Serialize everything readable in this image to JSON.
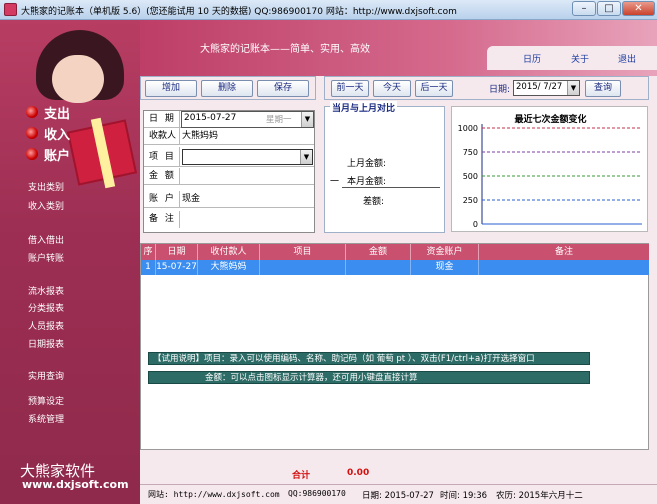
{
  "window": {
    "title": "大熊家的记账本（单机版 5.6）(您还能试用 10 天的数据)  QQ:986900170  网站：http://www.dxjsoft.com",
    "minimize": "–",
    "maximize": "□",
    "close": "✕"
  },
  "header": {
    "tagline": "大熊家的记账本——简单、实用、高效",
    "tabs": [
      "日历",
      "关于",
      "退出"
    ]
  },
  "sidebar": {
    "main": [
      "支出",
      "收入",
      "账户"
    ],
    "items": [
      "支出类别",
      "收入类别",
      "借入借出",
      "账户转账",
      "流水报表",
      "分类报表",
      "人员报表",
      "日期报表",
      "实用查询",
      "预算设定",
      "系统管理"
    ],
    "brand": "大熊家软件",
    "brand_url": "www.dxjsoft.com"
  },
  "toolbar": {
    "add": "增加",
    "delete": "删除",
    "save": "保存",
    "prev_day": "前一天",
    "today": "今天",
    "next_day": "后一天",
    "date_label": "日期:",
    "date_value": "2015/ 7/27",
    "query": "查询"
  },
  "form": {
    "date_label": "日 期",
    "date_value": "2015-07-27",
    "weekday": "星期一",
    "payee_label": "收款人",
    "payee_value": "大熊妈妈",
    "item_label": "项 目",
    "item_value": "",
    "amount_label": "金 额",
    "amount_value": "",
    "account_label": "账 户",
    "account_value": "现金",
    "remark_label": "备 注",
    "remark_value": ""
  },
  "compare": {
    "title": "当月与上月对比",
    "last_month": "上月金额:",
    "this_month": "本月金额:",
    "diff": "差额:",
    "dash": "一"
  },
  "chart_data": {
    "type": "line",
    "title": "最近七次金额变化",
    "yticks": [
      "1000",
      "750",
      "500",
      "250",
      "0"
    ],
    "ylim": [
      0,
      1000
    ],
    "series": []
  },
  "grid": {
    "headers": [
      "序",
      "日期",
      "收付款人",
      "项目",
      "金额",
      "资金账户",
      "备注"
    ],
    "rows": [
      [
        "1",
        "15-07-27",
        "大熊妈妈",
        "",
        "",
        "现金",
        ""
      ]
    ]
  },
  "notes": {
    "line1": "【试用说明】项目：录入可以使用编码、名称、助记码（如 葡萄 pt  ）、双击(F1/ctrl+a)打开选择窗口",
    "line2": "金额：可以点击图标显示计算器，还可用小键盘直接计算"
  },
  "totals": {
    "label": "合计",
    "value": "0.00"
  },
  "status": {
    "site": "网站: http://www.dxjsoft.com",
    "qq": "QQ:986900170",
    "date": "日期: 2015-07-27",
    "time": "时间: 19:36",
    "lunar": "农历: 2015年六月十二"
  },
  "colors": {
    "accent": "#c9506f",
    "row_selected": "#3b8ef0",
    "note_bg": "#2d6b66"
  }
}
